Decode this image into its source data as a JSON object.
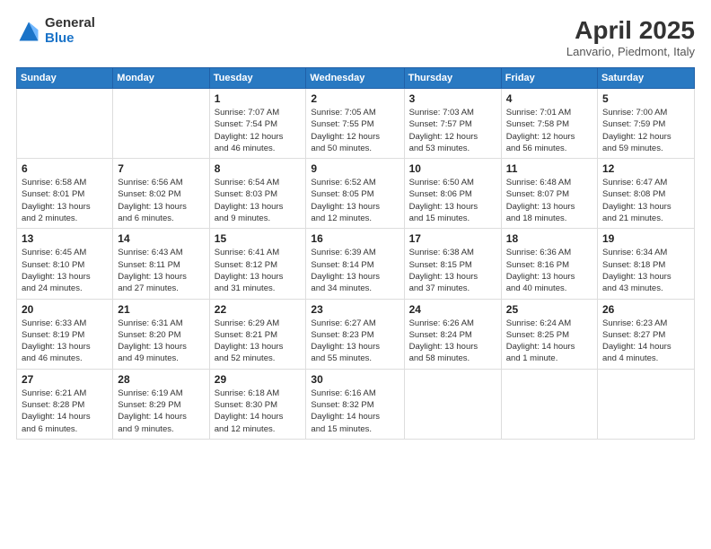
{
  "logo": {
    "general": "General",
    "blue": "Blue"
  },
  "title": {
    "month": "April 2025",
    "location": "Lanvario, Piedmont, Italy"
  },
  "weekdays": [
    "Sunday",
    "Monday",
    "Tuesday",
    "Wednesday",
    "Thursday",
    "Friday",
    "Saturday"
  ],
  "weeks": [
    [
      {
        "day": "",
        "detail": ""
      },
      {
        "day": "",
        "detail": ""
      },
      {
        "day": "1",
        "detail": "Sunrise: 7:07 AM\nSunset: 7:54 PM\nDaylight: 12 hours\nand 46 minutes."
      },
      {
        "day": "2",
        "detail": "Sunrise: 7:05 AM\nSunset: 7:55 PM\nDaylight: 12 hours\nand 50 minutes."
      },
      {
        "day": "3",
        "detail": "Sunrise: 7:03 AM\nSunset: 7:57 PM\nDaylight: 12 hours\nand 53 minutes."
      },
      {
        "day": "4",
        "detail": "Sunrise: 7:01 AM\nSunset: 7:58 PM\nDaylight: 12 hours\nand 56 minutes."
      },
      {
        "day": "5",
        "detail": "Sunrise: 7:00 AM\nSunset: 7:59 PM\nDaylight: 12 hours\nand 59 minutes."
      }
    ],
    [
      {
        "day": "6",
        "detail": "Sunrise: 6:58 AM\nSunset: 8:01 PM\nDaylight: 13 hours\nand 2 minutes."
      },
      {
        "day": "7",
        "detail": "Sunrise: 6:56 AM\nSunset: 8:02 PM\nDaylight: 13 hours\nand 6 minutes."
      },
      {
        "day": "8",
        "detail": "Sunrise: 6:54 AM\nSunset: 8:03 PM\nDaylight: 13 hours\nand 9 minutes."
      },
      {
        "day": "9",
        "detail": "Sunrise: 6:52 AM\nSunset: 8:05 PM\nDaylight: 13 hours\nand 12 minutes."
      },
      {
        "day": "10",
        "detail": "Sunrise: 6:50 AM\nSunset: 8:06 PM\nDaylight: 13 hours\nand 15 minutes."
      },
      {
        "day": "11",
        "detail": "Sunrise: 6:48 AM\nSunset: 8:07 PM\nDaylight: 13 hours\nand 18 minutes."
      },
      {
        "day": "12",
        "detail": "Sunrise: 6:47 AM\nSunset: 8:08 PM\nDaylight: 13 hours\nand 21 minutes."
      }
    ],
    [
      {
        "day": "13",
        "detail": "Sunrise: 6:45 AM\nSunset: 8:10 PM\nDaylight: 13 hours\nand 24 minutes."
      },
      {
        "day": "14",
        "detail": "Sunrise: 6:43 AM\nSunset: 8:11 PM\nDaylight: 13 hours\nand 27 minutes."
      },
      {
        "day": "15",
        "detail": "Sunrise: 6:41 AM\nSunset: 8:12 PM\nDaylight: 13 hours\nand 31 minutes."
      },
      {
        "day": "16",
        "detail": "Sunrise: 6:39 AM\nSunset: 8:14 PM\nDaylight: 13 hours\nand 34 minutes."
      },
      {
        "day": "17",
        "detail": "Sunrise: 6:38 AM\nSunset: 8:15 PM\nDaylight: 13 hours\nand 37 minutes."
      },
      {
        "day": "18",
        "detail": "Sunrise: 6:36 AM\nSunset: 8:16 PM\nDaylight: 13 hours\nand 40 minutes."
      },
      {
        "day": "19",
        "detail": "Sunrise: 6:34 AM\nSunset: 8:18 PM\nDaylight: 13 hours\nand 43 minutes."
      }
    ],
    [
      {
        "day": "20",
        "detail": "Sunrise: 6:33 AM\nSunset: 8:19 PM\nDaylight: 13 hours\nand 46 minutes."
      },
      {
        "day": "21",
        "detail": "Sunrise: 6:31 AM\nSunset: 8:20 PM\nDaylight: 13 hours\nand 49 minutes."
      },
      {
        "day": "22",
        "detail": "Sunrise: 6:29 AM\nSunset: 8:21 PM\nDaylight: 13 hours\nand 52 minutes."
      },
      {
        "day": "23",
        "detail": "Sunrise: 6:27 AM\nSunset: 8:23 PM\nDaylight: 13 hours\nand 55 minutes."
      },
      {
        "day": "24",
        "detail": "Sunrise: 6:26 AM\nSunset: 8:24 PM\nDaylight: 13 hours\nand 58 minutes."
      },
      {
        "day": "25",
        "detail": "Sunrise: 6:24 AM\nSunset: 8:25 PM\nDaylight: 14 hours\nand 1 minute."
      },
      {
        "day": "26",
        "detail": "Sunrise: 6:23 AM\nSunset: 8:27 PM\nDaylight: 14 hours\nand 4 minutes."
      }
    ],
    [
      {
        "day": "27",
        "detail": "Sunrise: 6:21 AM\nSunset: 8:28 PM\nDaylight: 14 hours\nand 6 minutes."
      },
      {
        "day": "28",
        "detail": "Sunrise: 6:19 AM\nSunset: 8:29 PM\nDaylight: 14 hours\nand 9 minutes."
      },
      {
        "day": "29",
        "detail": "Sunrise: 6:18 AM\nSunset: 8:30 PM\nDaylight: 14 hours\nand 12 minutes."
      },
      {
        "day": "30",
        "detail": "Sunrise: 6:16 AM\nSunset: 8:32 PM\nDaylight: 14 hours\nand 15 minutes."
      },
      {
        "day": "",
        "detail": ""
      },
      {
        "day": "",
        "detail": ""
      },
      {
        "day": "",
        "detail": ""
      }
    ]
  ]
}
